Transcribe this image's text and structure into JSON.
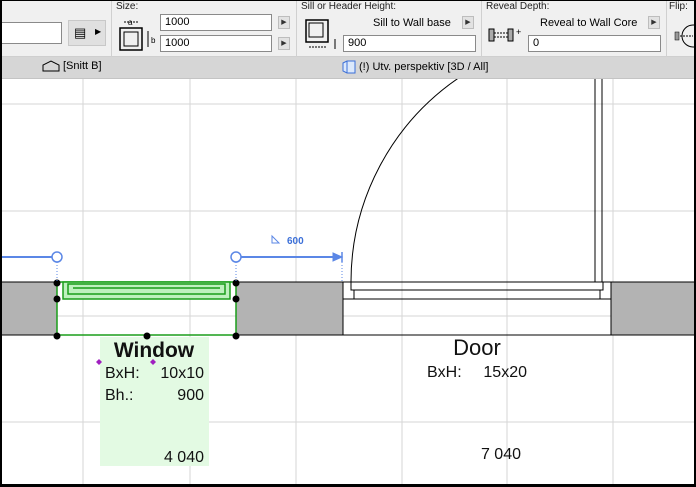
{
  "toolbar": {
    "left_field_value": "",
    "size": {
      "caption": "Size:",
      "width_value": "1000",
      "height_value": "1000",
      "width_label": "a",
      "height_label": "b"
    },
    "sill": {
      "caption": "Sill or Header Height:",
      "mode": "Sill to Wall base",
      "value": "900"
    },
    "reveal": {
      "caption": "Reveal Depth:",
      "mode": "Reveal to Wall Core",
      "value": "0"
    },
    "flip": {
      "caption": "Flip:"
    }
  },
  "tabs": [
    {
      "label": "[Snitt B]",
      "icon": "section-icon"
    },
    {
      "label": "(!) Utv. perspektiv [3D / All]",
      "icon": "3d-view-icon"
    }
  ],
  "drawing": {
    "dimension_label": "600",
    "window": {
      "title": "Window",
      "size_label": "BxH:",
      "size_value": "10x10",
      "sill_label": "Bh.:",
      "sill_value": "900",
      "elevation": "4 040"
    },
    "door": {
      "title": "Door",
      "size_label": "BxH:",
      "size_value": "15x20",
      "elevation": "7 040"
    },
    "colors": {
      "wall": "#b3b3b3",
      "selection": "#1a9e1a",
      "dimension": "#5b87e6",
      "label_bg": "#e3fae3",
      "hotspot": "#a020c0"
    }
  }
}
